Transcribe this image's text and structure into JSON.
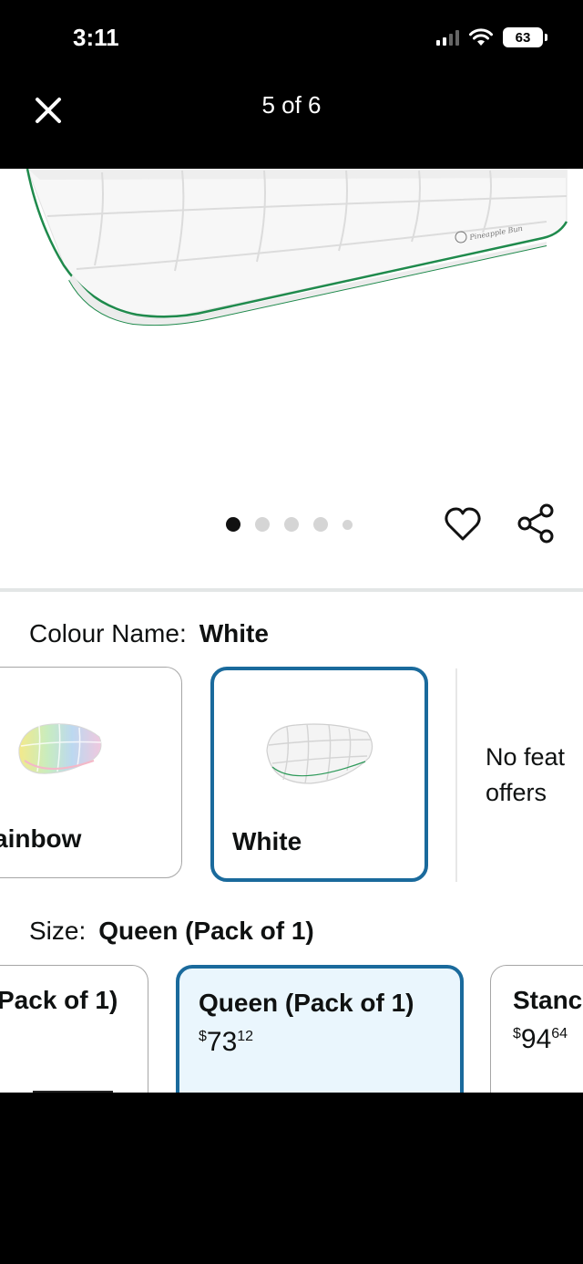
{
  "status_bar": {
    "time": "3:11",
    "battery": "63"
  },
  "nav": {
    "title": "5 of 6"
  },
  "product_image": {
    "brand_mark": "Pineapple Bun"
  },
  "carousel": {
    "count": 5,
    "active": 0
  },
  "colour": {
    "label": "Colour Name:",
    "value": "White",
    "options": [
      {
        "name": "ainbow"
      },
      {
        "name": "White"
      }
    ],
    "no_offers_line1": "No feat",
    "no_offers_line2": "offers"
  },
  "size": {
    "label": "Size:",
    "value": "Queen (Pack of 1)",
    "options": [
      {
        "name": "Pack of 1)"
      },
      {
        "name": "Queen (Pack of 1)",
        "currency": "$",
        "price_whole": "73",
        "price_fraction": "12"
      },
      {
        "name": "Stanc",
        "currency": "$",
        "price_whole": "94",
        "price_fraction": "64"
      }
    ]
  },
  "colors": {
    "accent": "#1a6a9c",
    "selected_bg": "#eaf6fd",
    "pillow_trim": "#1f8a4c"
  }
}
